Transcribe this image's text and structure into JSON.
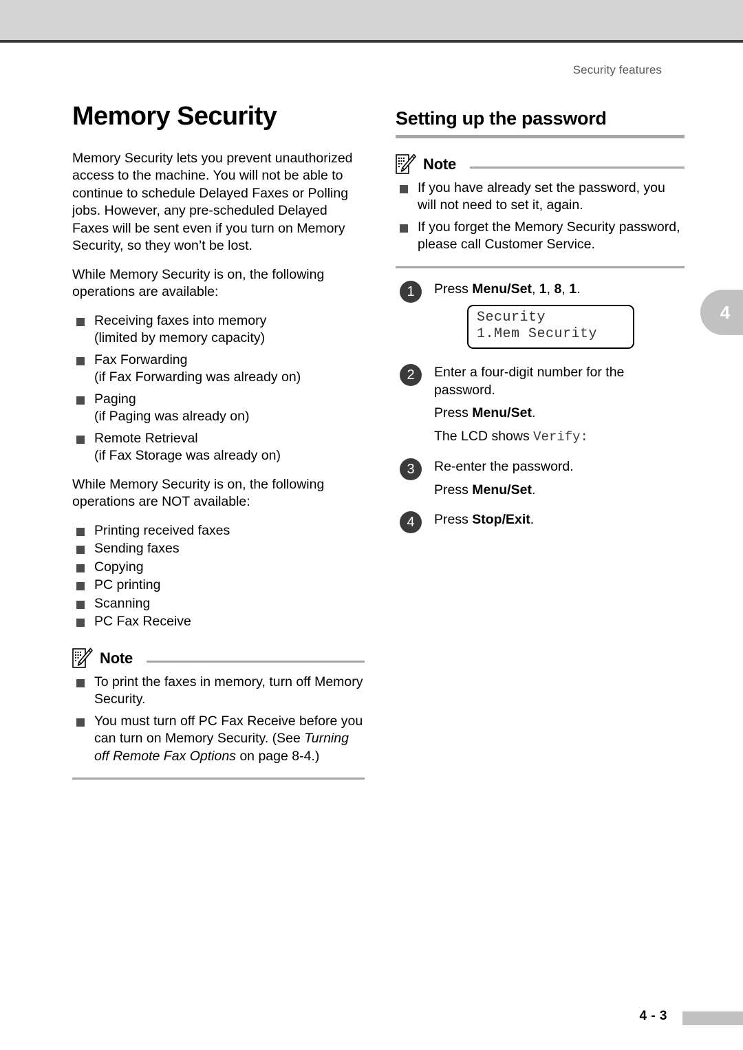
{
  "header": {
    "running_title": "Security features"
  },
  "chapter_tab": {
    "number": "4"
  },
  "footer": {
    "page_number": "4 - 3"
  },
  "left_column": {
    "title": "Memory Security",
    "intro_paragraphs": [
      "Memory Security lets you prevent unauthorized access to the machine. You will not be able to continue to schedule Delayed Faxes or Polling jobs. However, any pre-scheduled Delayed Faxes will be sent even if you turn on Memory Security, so they won’t be lost.",
      "While Memory Security is on, the following operations are available:"
    ],
    "available_items": [
      {
        "main": "Receiving faxes into memory",
        "sub": "(limited by memory capacity)"
      },
      {
        "main": "Fax Forwarding",
        "sub": "(if Fax Forwarding was already on)"
      },
      {
        "main": "Paging",
        "sub": "(if Paging was already on)"
      },
      {
        "main": "Remote Retrieval",
        "sub": "(if Fax Storage was already on)"
      }
    ],
    "not_available_lead": "While Memory Security is on, the following operations are NOT available:",
    "not_available_items": [
      "Printing received faxes",
      "Sending faxes",
      "Copying",
      "PC printing",
      "Scanning",
      "PC Fax Receive"
    ],
    "note": {
      "label": "Note",
      "items": [
        {
          "text": "To print the faxes in memory, turn off Memory Security."
        },
        {
          "text_before": "You must turn off PC Fax Receive before you can turn on Memory Security. (See ",
          "italic": "Turning off Remote Fax Options",
          "text_after": " on page 8-4.)"
        }
      ]
    }
  },
  "right_column": {
    "title": "Setting up the password",
    "note": {
      "label": "Note",
      "items": [
        "If you have already set the password, you will not need to set it, again.",
        "If you forget the Memory Security password, please call Customer Service."
      ]
    },
    "steps": [
      {
        "number": "1",
        "lines": [
          {
            "before": "Press ",
            "bold": "Menu/Set",
            "after": ", ",
            "bold2": "1",
            "after2": ", ",
            "bold3": "8",
            "after3": ", ",
            "bold4": "1",
            "after4": "."
          }
        ],
        "lcd": {
          "line1": "Security",
          "line2": "1.Mem Security"
        }
      },
      {
        "number": "2",
        "plain_first": "Enter a four-digit number for the password.",
        "press_before": "Press ",
        "press_bold": "Menu/Set",
        "press_after": ".",
        "lcd_note_before": "The LCD shows ",
        "lcd_note_mono": "Verify:"
      },
      {
        "number": "3",
        "plain_first": "Re-enter the password.",
        "press_before": "Press ",
        "press_bold": "Menu/Set",
        "press_after": "."
      },
      {
        "number": "4",
        "press_before": "Press ",
        "press_bold": "Stop/Exit",
        "press_after": "."
      }
    ]
  }
}
